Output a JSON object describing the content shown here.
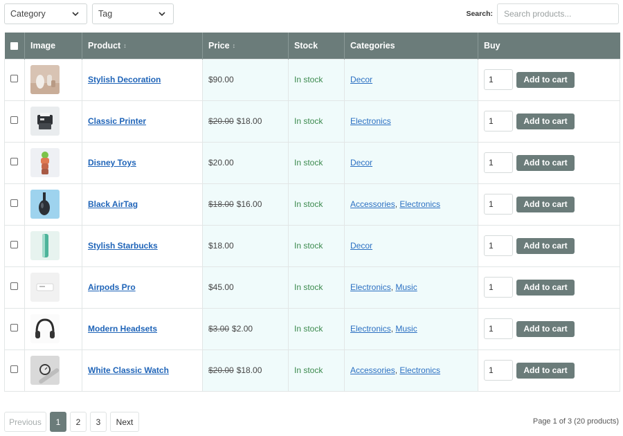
{
  "filters": {
    "category_label": "Category",
    "tag_label": "Tag",
    "search_label": "Search:",
    "search_placeholder": "Search products..."
  },
  "table": {
    "headers": {
      "image": "Image",
      "product": "Product",
      "price": "Price",
      "stock": "Stock",
      "categories": "Categories",
      "buy": "Buy"
    },
    "sort_icon": "↕",
    "cart_label": "Add to cart",
    "rows": [
      {
        "name": "Stylish Decoration",
        "old_price": "",
        "price": "$90.00",
        "stock": "In stock",
        "cat1": "Decor",
        "cat2": "",
        "sep": "",
        "qty": "1",
        "thumb_icon": "vase-icon"
      },
      {
        "name": "Classic Printer",
        "old_price": "$20.00",
        "price": "$18.00",
        "stock": "In stock",
        "cat1": "Electronics",
        "cat2": "",
        "sep": "",
        "qty": "1",
        "thumb_icon": "printer-icon"
      },
      {
        "name": "Disney Toys",
        "old_price": "",
        "price": "$20.00",
        "stock": "In stock",
        "cat1": "Decor",
        "cat2": "",
        "sep": "",
        "qty": "1",
        "thumb_icon": "toy-icon"
      },
      {
        "name": "Black AirTag",
        "old_price": "$18.00",
        "price": "$16.00",
        "stock": "In stock",
        "cat1": "Accessories",
        "cat2": "Electronics",
        "sep": ", ",
        "qty": "1",
        "thumb_icon": "airtag-icon"
      },
      {
        "name": "Stylish Starbucks",
        "old_price": "",
        "price": "$18.00",
        "stock": "In stock",
        "cat1": "Decor",
        "cat2": "",
        "sep": "",
        "qty": "1",
        "thumb_icon": "bottle-icon"
      },
      {
        "name": "Airpods Pro",
        "old_price": "",
        "price": "$45.00",
        "stock": "In stock",
        "cat1": "Electronics",
        "cat2": "Music",
        "sep": ", ",
        "qty": "1",
        "thumb_icon": "airpods-icon"
      },
      {
        "name": "Modern Headsets",
        "old_price": "$3.00",
        "price": "$2.00",
        "stock": "In stock",
        "cat1": "Electronics",
        "cat2": "Music",
        "sep": ", ",
        "qty": "1",
        "thumb_icon": "headphones-icon"
      },
      {
        "name": "White Classic Watch",
        "old_price": "$20.00",
        "price": "$18.00",
        "stock": "In stock",
        "cat1": "Accessories",
        "cat2": "Electronics",
        "sep": ", ",
        "qty": "1",
        "thumb_icon": "watch-icon"
      }
    ]
  },
  "pagination": {
    "previous": "Previous",
    "pages": [
      "1",
      "2",
      "3"
    ],
    "current": "1",
    "next": "Next",
    "info": "Page 1 of 3 (20 products)"
  },
  "colors": {
    "header_bg": "#6b7c7a",
    "highlight_col_bg": "#f0fbfb",
    "link": "#1f64b8",
    "in_stock": "#3c8a4e"
  }
}
